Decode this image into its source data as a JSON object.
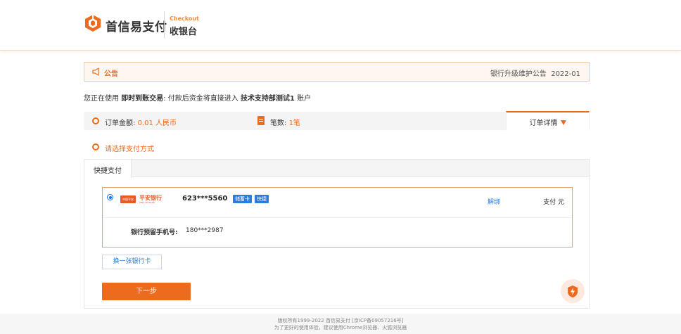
{
  "header": {
    "brand_name": "首信易支付",
    "checkout_en": "Checkout",
    "checkout_cn": "收银台"
  },
  "notice": {
    "title": "公告",
    "message": "银行升级维护公告",
    "date": "2022-01"
  },
  "info": {
    "prefix": "您正在使用",
    "trade_type": "即时到账交易",
    "middle": ": 付款后资金将直接进入",
    "account_name": "技术支持部测试1",
    "suffix": "账户"
  },
  "order": {
    "amount_label": "订单金额:",
    "amount_value": "0.01 人民币",
    "count_label": "笔数:",
    "count_value": "1笔",
    "details_label": "订单详情"
  },
  "select_method": "请选择支付方式",
  "tabs": [
    {
      "label": "快捷支付",
      "active": true
    }
  ],
  "card": {
    "bank_name": "平安银行",
    "bank_name_en": "PING AN BANK",
    "bank_mark": "中国平安",
    "card_number": "623***5560",
    "tags": [
      "储蓄卡",
      "快捷"
    ],
    "unbind_label": "解绑",
    "pay_label": "支付",
    "currency_unit": "元",
    "phone_label": "银行预留手机号:",
    "phone_value": "180***2987",
    "selected": true
  },
  "buttons": {
    "change_card": "换一张银行卡",
    "next": "下一步"
  },
  "footer": {
    "copyright": "版权所有1999-2022 首信易支付 [京ICP备09057216号]",
    "browser_tip": "为了更好的使用体验，建议使用Chrome浏览器、火狐浏览器"
  },
  "colors": {
    "accent": "#ec6b1e",
    "link": "#2d7be0",
    "notice_bg": "#fff7ef"
  },
  "icons": {
    "logo": "shouxin-logo-icon",
    "notice": "megaphone-icon",
    "amount": "ring-icon",
    "count": "document-icon",
    "details": "triangle-down-icon",
    "float": "lightning-shield-icon"
  }
}
